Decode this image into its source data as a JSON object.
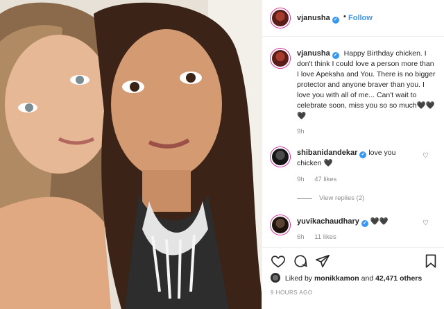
{
  "post": {
    "author": "vjanusha",
    "follow_label": "Follow",
    "separator": "•"
  },
  "caption": {
    "username": "vjanusha",
    "text": "Happy Birthday chicken. I don't think I could love a person more than I love Apeksha and You. There is no bigger protector and anyone braver than you. I love you with all of me... Can't wait to celebrate soon, miss you so so much🖤🖤🖤",
    "time": "9h"
  },
  "comments": [
    {
      "username": "shibanidandekar",
      "text": "love you chicken 🖤",
      "time": "9h",
      "likes": "47 likes",
      "view_replies": "View replies (2)"
    },
    {
      "username": "yuvikachaudhary",
      "text": "🖤🖤",
      "time": "6h",
      "likes": "11 likes"
    }
  ],
  "likes": {
    "prefix": "Liked by",
    "user": "monikkamon",
    "conjunction": "and",
    "others": "42,471 others"
  },
  "timestamp": "9 HOURS AGO",
  "icons": {
    "verified": "verified-badge-icon",
    "heart": "heart-icon",
    "comment": "comment-icon",
    "share": "share-icon",
    "save": "bookmark-icon"
  },
  "colors": {
    "link_blue": "#3897f0",
    "muted": "#8e8e8e",
    "text": "#262626"
  }
}
